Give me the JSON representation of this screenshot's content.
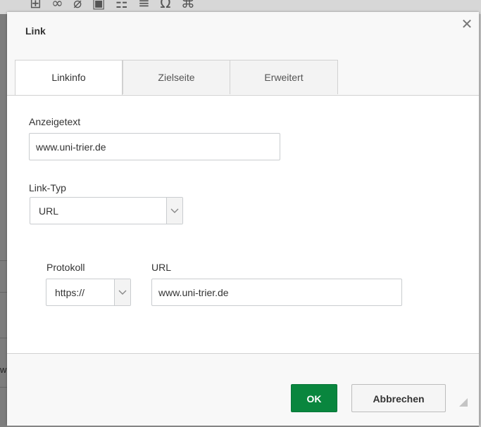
{
  "background_toolbar": {
    "icons": [
      "format-icon",
      "link-icon",
      "unlink-icon",
      "image-icon",
      "table-icon",
      "hr-icon",
      "special-char-icon",
      "maximize-icon"
    ]
  },
  "dialog": {
    "title": "Link",
    "close_icon": "close-icon",
    "tabs": [
      {
        "label": "Linkinfo",
        "active": true
      },
      {
        "label": "Zielseite",
        "active": false
      },
      {
        "label": "Erweitert",
        "active": false
      }
    ],
    "display_text": {
      "label": "Anzeigetext",
      "value": "www.uni-trier.de"
    },
    "link_type": {
      "label": "Link-Typ",
      "selected": "URL"
    },
    "protocol": {
      "label": "Protokoll",
      "selected": "https://"
    },
    "url": {
      "label": "URL",
      "value": "www.uni-trier.de"
    },
    "buttons": {
      "ok": "OK",
      "cancel": "Abbrechen"
    }
  },
  "background_fragment": {
    "text": "w"
  },
  "colors": {
    "ok_green": "#09863e",
    "border": "#d1d1d1",
    "panel": "#f8f8f8"
  }
}
